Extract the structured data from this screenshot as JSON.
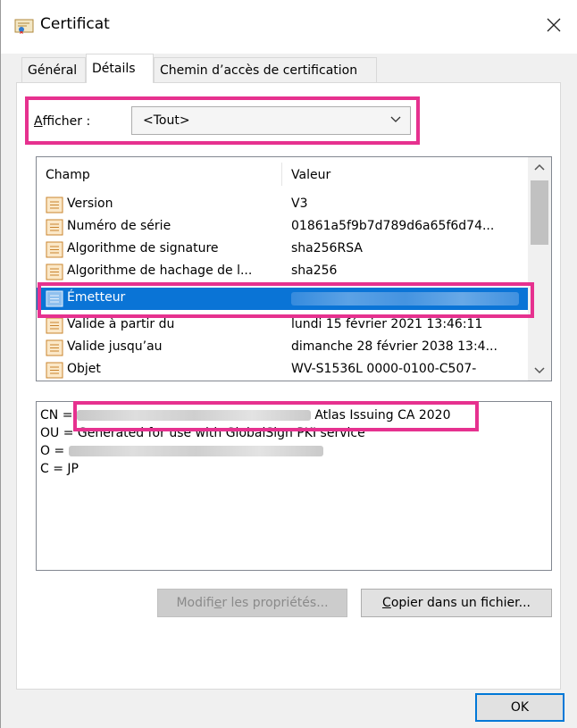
{
  "window": {
    "title": "Certificat"
  },
  "tabs": [
    {
      "label": "Général"
    },
    {
      "label": "Détails"
    },
    {
      "label": "Chemin d’accès de certification"
    }
  ],
  "show": {
    "label_underlined": "A",
    "label_rest": "fficher :",
    "selected": "<Tout>"
  },
  "list": {
    "columns": {
      "field": "Champ",
      "value": "Valeur"
    },
    "rows": [
      {
        "field": "Version",
        "value": "V3"
      },
      {
        "field": "Numéro de série",
        "value": "01861a5f9b7d789d6a65f6d74..."
      },
      {
        "field": "Algorithme de signature",
        "value": "sha256RSA"
      },
      {
        "field": "Algorithme de hachage de l...",
        "value": "sha256"
      },
      {
        "field": "Émetteur",
        "value": ""
      },
      {
        "field": "Valide à partir du",
        "value": "lundi 15 février 2021 13:46:11"
      },
      {
        "field": "Valide jusqu’au",
        "value": "dimanche 28 février 2038 13:4..."
      },
      {
        "field": "Objet",
        "value": "WV-S1536L 0000-0100-C507-"
      }
    ]
  },
  "details": {
    "cn_prefix": "CN =",
    "cn_visible": "Atlas Issuing CA 2020",
    "ou": "OU = Generated for use with GlobalSign PKI service",
    "o_prefix": "O =",
    "c": "C = JP"
  },
  "buttons": {
    "edit_prefix": "Modifi",
    "edit_ul": "e",
    "edit_rest": "r les propriétés...",
    "copy_ul": "C",
    "copy_rest": "opier dans un fichier...",
    "ok": "OK"
  },
  "colors": {
    "highlight": "#e6318f",
    "selection": "#0a74d6"
  }
}
